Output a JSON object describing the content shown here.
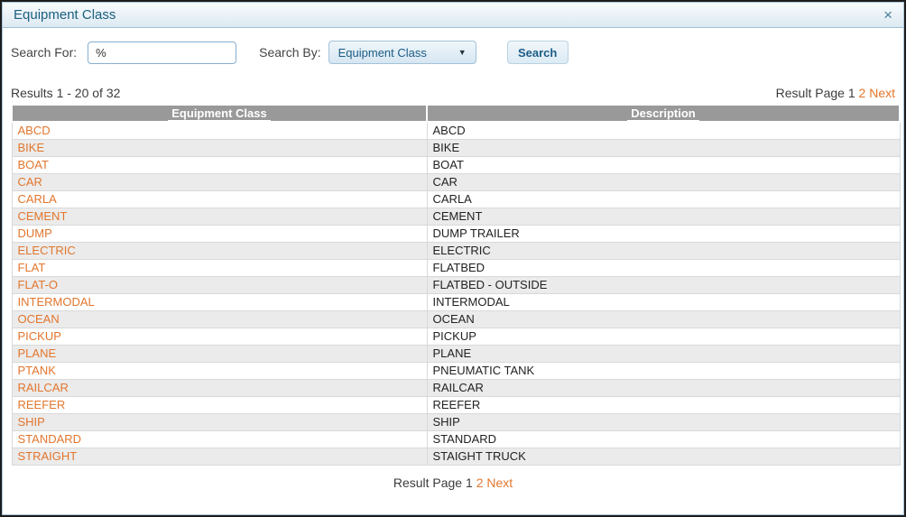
{
  "dialog": {
    "title": "Equipment Class",
    "close_glyph": "×"
  },
  "search": {
    "search_for_label": "Search For:",
    "search_for_value": "%",
    "search_by_label": "Search By:",
    "search_by_selected": "Equipment Class",
    "dropdown_arrow_glyph": "▼",
    "search_button_label": "Search"
  },
  "results": {
    "summary": "Results 1 - 20 of 32",
    "pagination": {
      "label": "Result Page",
      "current_page": "1",
      "page_links": [
        "2"
      ],
      "next_label": "Next"
    }
  },
  "table": {
    "columns": [
      "Equipment Class",
      "Description"
    ],
    "rows": [
      {
        "equipment_class": "ABCD",
        "description": "ABCD"
      },
      {
        "equipment_class": "BIKE",
        "description": "BIKE"
      },
      {
        "equipment_class": "BOAT",
        "description": "BOAT"
      },
      {
        "equipment_class": "CAR",
        "description": "CAR"
      },
      {
        "equipment_class": "CARLA",
        "description": "CARLA"
      },
      {
        "equipment_class": "CEMENT",
        "description": "CEMENT"
      },
      {
        "equipment_class": "DUMP",
        "description": "DUMP TRAILER"
      },
      {
        "equipment_class": "ELECTRIC",
        "description": "ELECTRIC"
      },
      {
        "equipment_class": "FLAT",
        "description": "FLATBED"
      },
      {
        "equipment_class": "FLAT-O",
        "description": "FLATBED - OUTSIDE"
      },
      {
        "equipment_class": "INTERMODAL",
        "description": "INTERMODAL"
      },
      {
        "equipment_class": "OCEAN",
        "description": "OCEAN"
      },
      {
        "equipment_class": "PICKUP",
        "description": "PICKUP"
      },
      {
        "equipment_class": "PLANE",
        "description": "PLANE"
      },
      {
        "equipment_class": "PTANK",
        "description": "PNEUMATIC TANK"
      },
      {
        "equipment_class": "RAILCAR",
        "description": "RAILCAR"
      },
      {
        "equipment_class": "REEFER",
        "description": "REEFER"
      },
      {
        "equipment_class": "SHIP",
        "description": "SHIP"
      },
      {
        "equipment_class": "STANDARD",
        "description": "STANDARD"
      },
      {
        "equipment_class": "STRAIGHT",
        "description": "STAIGHT TRUCK"
      }
    ]
  },
  "colors": {
    "accent_orange": "#e2762e",
    "title_blue": "#1a5f7e",
    "header_gray": "#999999",
    "alt_row_gray": "#ebebeb",
    "button_text_blue": "#1c5c86"
  }
}
